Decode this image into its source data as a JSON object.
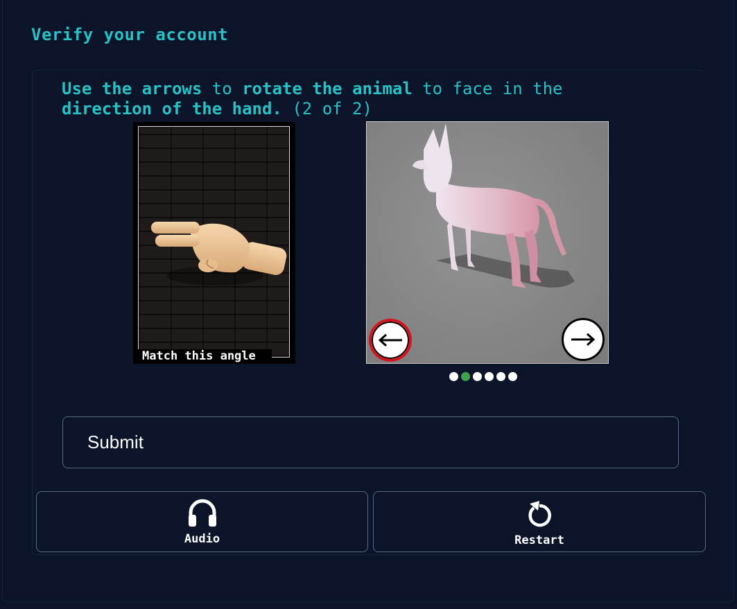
{
  "page": {
    "title": "Verify your account"
  },
  "challenge": {
    "instruction_parts": [
      {
        "text": "Use the arrows",
        "bold": true
      },
      {
        "text": " to ",
        "bold": false
      },
      {
        "text": "rotate the animal",
        "bold": true
      },
      {
        "text": " to face in the ",
        "bold": false
      },
      {
        "text": "direction of the hand.",
        "bold": true
      },
      {
        "text": " (2 of 2)",
        "bold": false
      }
    ],
    "reference_label": "Match this angle",
    "current_step": 2,
    "total_steps": 6
  },
  "controls": {
    "rotate_left_icon": "arrow-left-icon",
    "rotate_right_icon": "arrow-right-icon",
    "submit_label": "Submit",
    "audio_label": "Audio",
    "audio_icon": "headphones-icon",
    "restart_label": "Restart",
    "restart_icon": "restart-icon"
  },
  "colors": {
    "background": "#0b1429",
    "accent": "#27c2c6",
    "active_dot": "#3ea34e",
    "left_arrow_ring": "#d4141d"
  }
}
